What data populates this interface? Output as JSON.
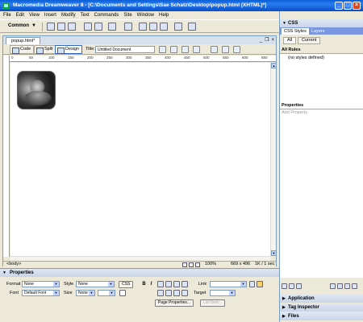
{
  "window": {
    "title": "Macromedia Dreamweaver 8 - [C:\\Documents and Settings\\Sae Schatz\\Desktop\\popup.html (XHTML)*]",
    "btn_min": "_",
    "btn_max": "□",
    "btn_close": "×"
  },
  "menu": [
    "File",
    "Edit",
    "View",
    "Insert",
    "Modify",
    "Text",
    "Commands",
    "Site",
    "Window",
    "Help"
  ],
  "insert_bar": {
    "category": "Common",
    "arrow": "▼"
  },
  "document": {
    "tab": "popup.html*",
    "ctrl_min": "_",
    "ctrl_restore": "❐",
    "ctrl_close": "×",
    "view_code": "Code",
    "view_split": "Split",
    "view_design": "Design",
    "title_label": "Title:",
    "title_value": "Untitled Document",
    "ruler_labels": [
      "0",
      "50",
      "100",
      "150",
      "200",
      "250",
      "300",
      "350",
      "400",
      "450",
      "500",
      "550",
      "600",
      "650"
    ]
  },
  "status": {
    "tag": "<body>",
    "zoom": "100%",
    "dimensions": "669 x 496",
    "download": "1K / 1 sec"
  },
  "properties": {
    "header": "Properties",
    "format_label": "Format",
    "format_value": "None",
    "style_label": "Style",
    "style_value": "None",
    "css_button": "CSS",
    "bold": "B",
    "italic": "I",
    "link_label": "Link",
    "font_label": "Font",
    "font_value": "Default Font",
    "size_label": "Size",
    "size_value": "None",
    "target_label": "Target",
    "page_properties": "Page Properties...",
    "list_item": "List Item..."
  },
  "panels": {
    "css_header": "CSS",
    "tab_css_styles": "CSS Styles",
    "tab_layers": "Layers",
    "seg_all": "All",
    "seg_current": "Current",
    "all_rules_label": "All Rules",
    "no_styles": "(no styles defined)",
    "properties_label": "Properties",
    "add_property": "Add Property",
    "application": "Application",
    "tag_inspector": "Tag Inspector",
    "files": "Files"
  }
}
